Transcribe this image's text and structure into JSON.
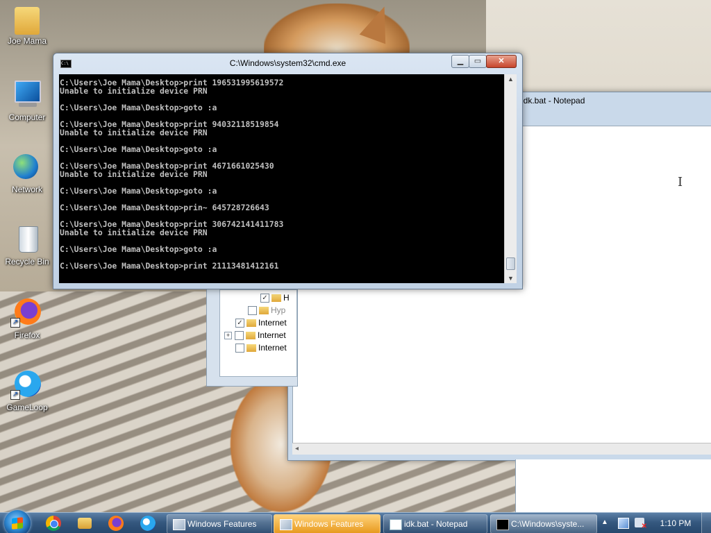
{
  "desktop": {
    "icons": [
      {
        "label": "Joe Mama",
        "icon": "user-folder-icon"
      },
      {
        "label": "Computer",
        "icon": "computer-icon"
      },
      {
        "label": "Network",
        "icon": "network-icon"
      },
      {
        "label": "Recycle Bin",
        "icon": "recycle-bin-icon"
      },
      {
        "label": "Firefox",
        "icon": "firefox-icon"
      },
      {
        "label": "GameLoop",
        "icon": "gameloop-icon"
      }
    ]
  },
  "notepad": {
    "title": "idk.bat - Notepad"
  },
  "windows_features": {
    "tree": [
      {
        "label": "H",
        "checked": true
      },
      {
        "label": "Hyp",
        "checked": false
      },
      {
        "label": "Internet",
        "checked": true
      },
      {
        "label": "Internet",
        "checked": false,
        "expandable": true
      },
      {
        "label": "Internet",
        "checked": false
      }
    ]
  },
  "cmd": {
    "title": "C:\\Windows\\system32\\cmd.exe",
    "output": "C:\\Users\\Joe Mama\\Desktop>print 196531995619572\nUnable to initialize device PRN\n\nC:\\Users\\Joe Mama\\Desktop>goto :a\n\nC:\\Users\\Joe Mama\\Desktop>print 94032118519854\nUnable to initialize device PRN\n\nC:\\Users\\Joe Mama\\Desktop>goto :a\n\nC:\\Users\\Joe Mama\\Desktop>print 4671661025430\nUnable to initialize device PRN\n\nC:\\Users\\Joe Mama\\Desktop>goto :a\n\nC:\\Users\\Joe Mama\\Desktop>prin~ 645728726643\n\nC:\\Users\\Joe Mama\\Desktop>print 306742141411783\nUnable to initialize device PRN\n\nC:\\Users\\Joe Mama\\Desktop>goto :a\n\nC:\\Users\\Joe Mama\\Desktop>print 21113481412161"
  },
  "taskbar": {
    "pinned": [
      "chrome-icon",
      "explorer-icon",
      "firefox-icon",
      "gameloop-icon"
    ],
    "tasks": [
      {
        "label": "Windows Features",
        "icon": "windows-features-icon"
      },
      {
        "label": "Windows Features",
        "icon": "windows-features-icon",
        "active": true
      },
      {
        "label": "idk.bat - Notepad",
        "icon": "notepad-icon"
      },
      {
        "label": "C:\\Windows\\syste...",
        "icon": "cmd-icon"
      }
    ],
    "clock": "1:10 PM"
  }
}
